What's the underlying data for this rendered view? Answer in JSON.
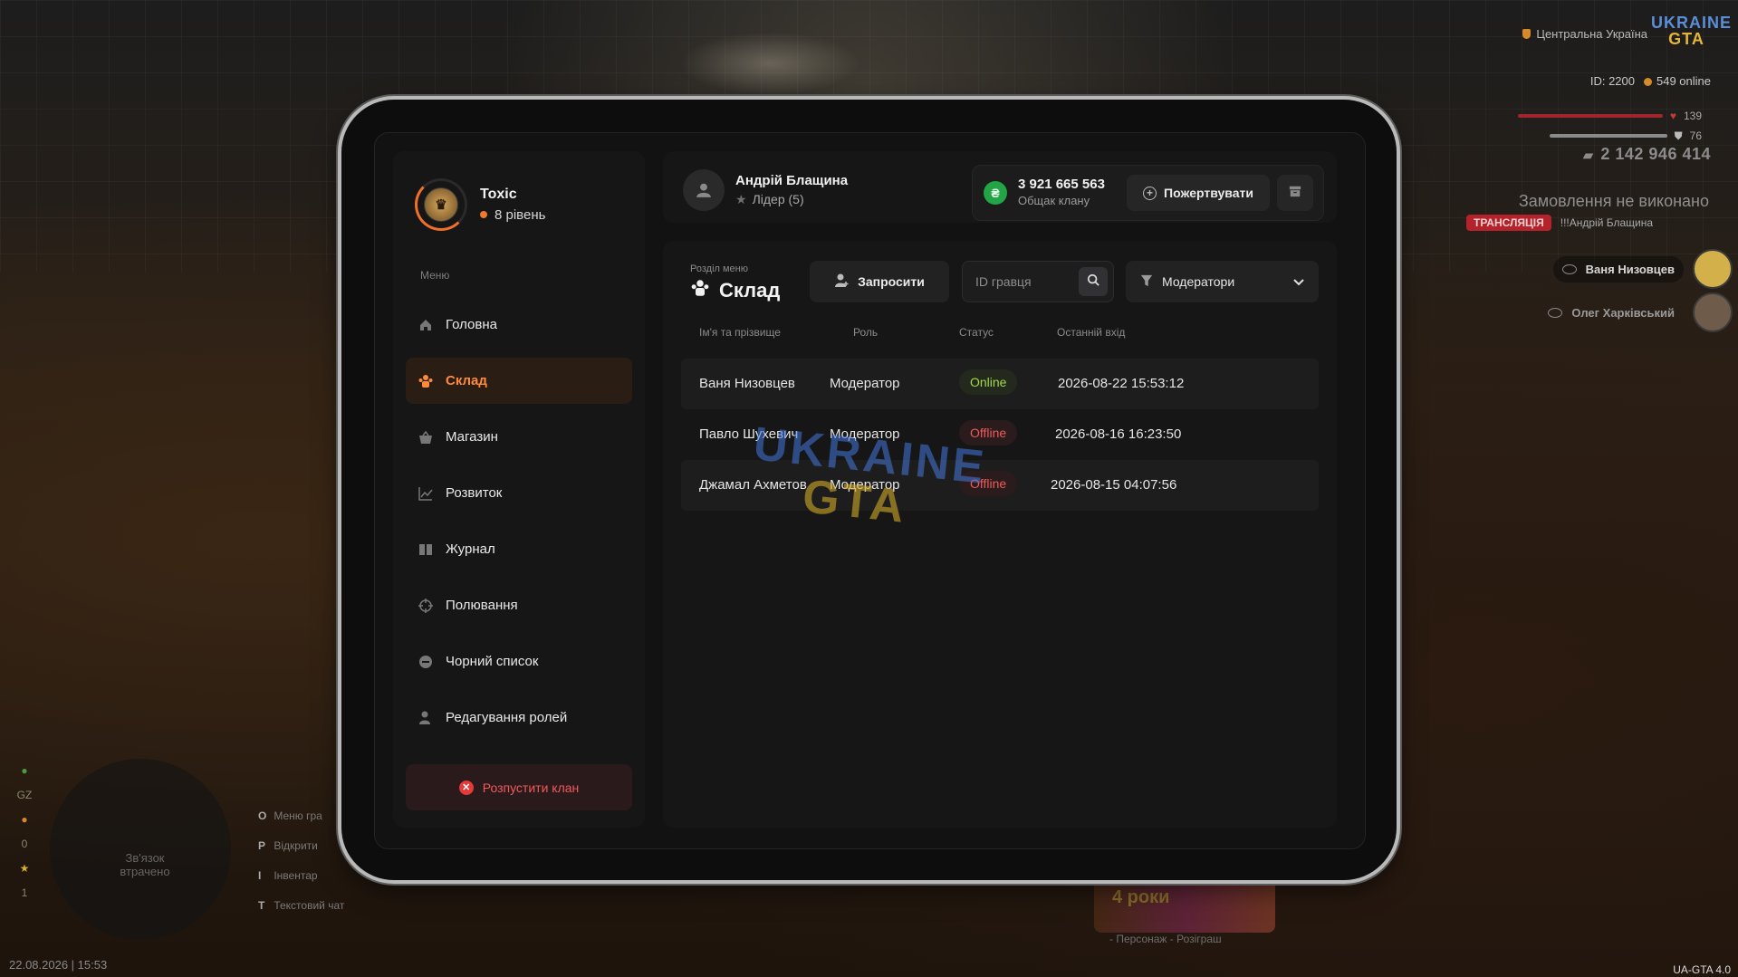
{
  "hud": {
    "region": "Центральна Україна",
    "logo_top": "UKRAINE",
    "logo_bottom": "GTA",
    "player_id": "ID: 2200",
    "online": "549 online",
    "health": "139",
    "armor": "76",
    "money": "2 142 946 414",
    "order_title": "Замовлення не виконано",
    "broadcast_badge": "ТРАНСЛЯЦІЯ",
    "broadcast_name": "!!!Андрій Блащина",
    "watchers": [
      "Ваня Низовцев",
      "Олег Харківський"
    ],
    "minimap_text": "Зв'язок втрачено",
    "side_values": [
      "GZ",
      "0",
      "1"
    ],
    "keys": [
      {
        "key": "O",
        "label": "Меню гра"
      },
      {
        "key": "P",
        "label": "Відкрити"
      },
      {
        "key": "I",
        "label": "Інвентар"
      },
      {
        "key": "T",
        "label": "Текстовий чат"
      }
    ],
    "datetime": "22.08.2026 | 15:53",
    "version": "UA-GTA 4.0",
    "banner_label": "4 роки",
    "banner_text": "- Персонаж - Розіграш"
  },
  "profile": {
    "clan": "Toxic",
    "level": "8 рівень"
  },
  "menu": {
    "label": "Меню",
    "items": [
      {
        "label": "Головна",
        "icon": "home-icon",
        "active": false
      },
      {
        "label": "Склад",
        "icon": "people-icon",
        "active": true
      },
      {
        "label": "Магазин",
        "icon": "basket-icon",
        "active": false
      },
      {
        "label": "Розвиток",
        "icon": "chart-icon",
        "active": false
      },
      {
        "label": "Журнал",
        "icon": "book-icon",
        "active": false
      },
      {
        "label": "Полювання",
        "icon": "crosshair-icon",
        "active": false
      },
      {
        "label": "Чорний список",
        "icon": "block-icon",
        "active": false
      },
      {
        "label": "Редагування ролей",
        "icon": "user-edit-icon",
        "active": false
      }
    ],
    "dissolve": "Розпустити клан"
  },
  "header": {
    "owner_name": "Андрій Блащина",
    "owner_role": "Лідер (5)",
    "amount": "3 921 665 563",
    "amount_label": "Общак клану",
    "donate": "Пожертвувати"
  },
  "section": {
    "label": "Розділ меню",
    "title": "Склад",
    "invite": "Запросити",
    "search_placeholder": "ID гравця",
    "filter": "Модератори"
  },
  "table": {
    "columns": [
      "Ім'я та прізвище",
      "Роль",
      "Статус",
      "Останній вхід"
    ],
    "rows": [
      {
        "name": "Ваня Низовцев",
        "role": "Модератор",
        "status": "Online",
        "last": "2026-08-22 15:53:12"
      },
      {
        "name": "Павло Шухевич",
        "role": "Модератор",
        "status": "Offline",
        "last": "2026-08-16 16:23:50"
      },
      {
        "name": "Джамал Ахметов",
        "role": "Модератор",
        "status": "Offline",
        "last": "2026-08-15 04:07:56"
      }
    ]
  },
  "colors": {
    "accent": "#ff8a3a",
    "online": "#a6d84a",
    "offline": "#f05a5a",
    "money": "#22a447"
  }
}
